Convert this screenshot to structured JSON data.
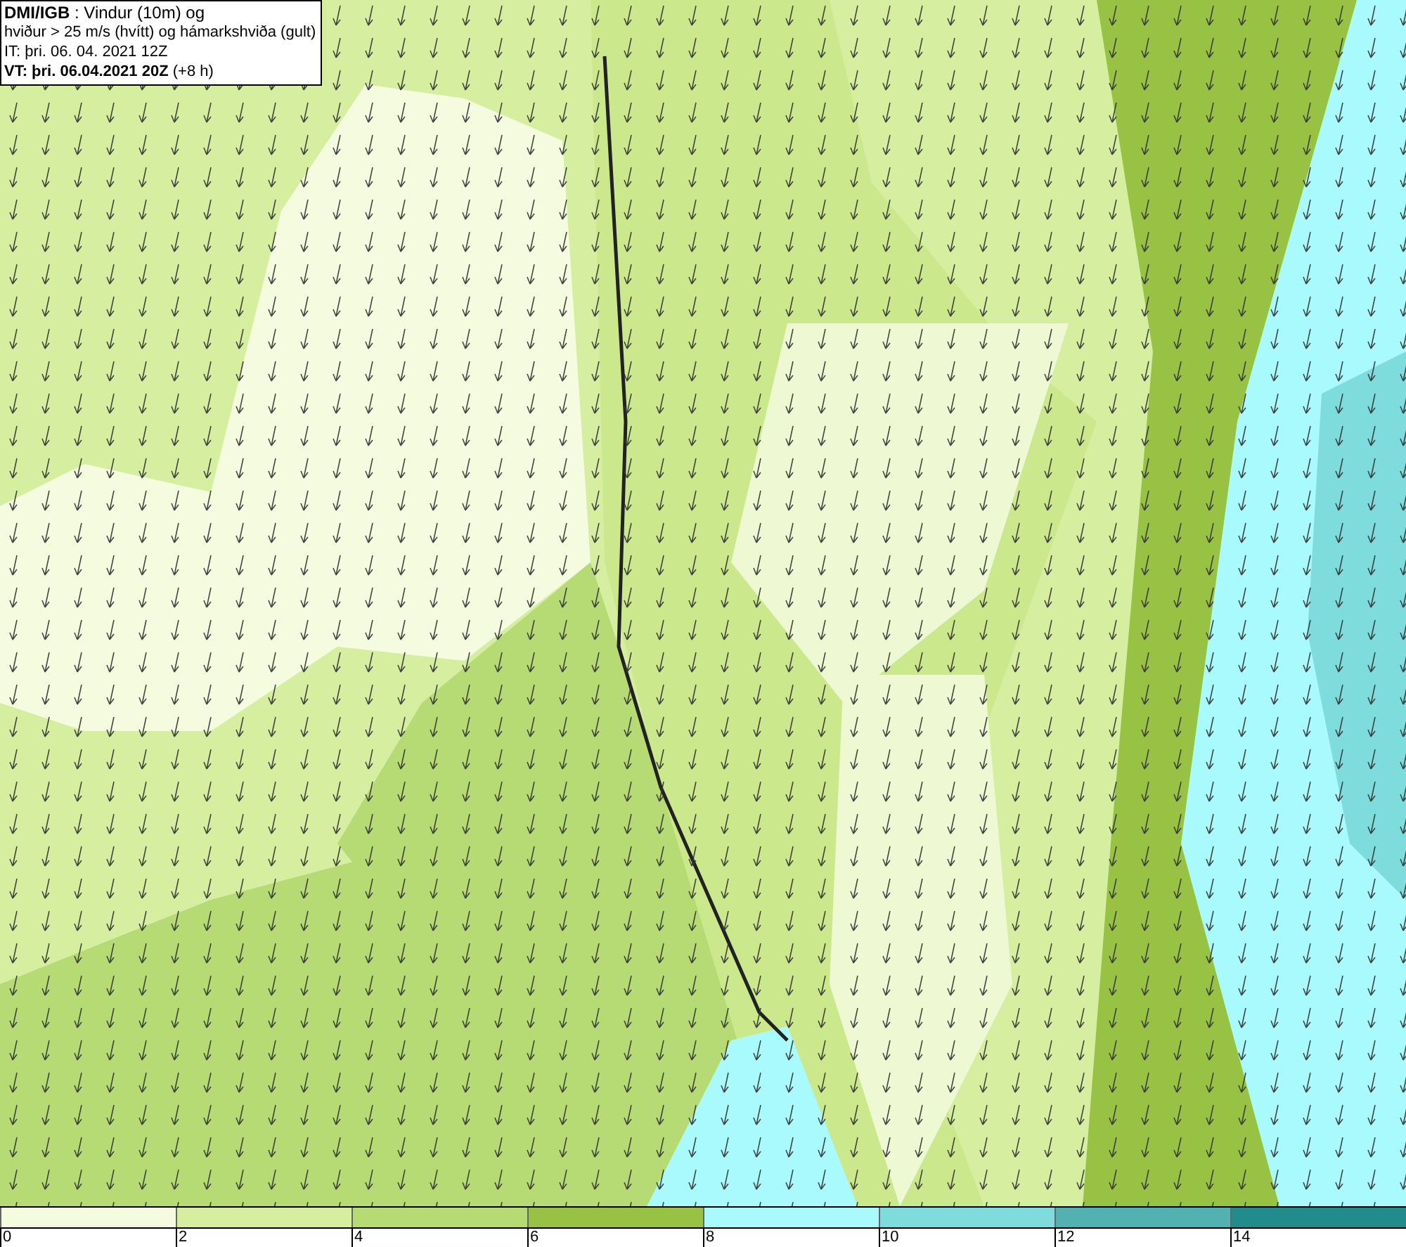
{
  "info": {
    "lines": [
      "**DMI/IGB** : Vindur (10m) og",
      "hviður > 25 m/s (hvítt) og hámarkshviða (gult)",
      "IT: þri. 06. 04. 2021 12Z",
      "**VT: þri. 06.04.2021 20Z** (+8 h)"
    ]
  },
  "legend": {
    "bins": [
      {
        "color": "#f4fbdf"
      },
      {
        "color": "#d6eea0"
      },
      {
        "color": "#b6da74"
      },
      {
        "color": "#98c244"
      },
      {
        "color": "#a8fafc"
      },
      {
        "color": "#7edcdc"
      },
      {
        "color": "#52b2b2"
      },
      {
        "color": "#228c8c"
      }
    ],
    "ticks": [
      "0",
      "2",
      "4",
      "6",
      "8",
      "10",
      "12",
      "14"
    ]
  }
}
